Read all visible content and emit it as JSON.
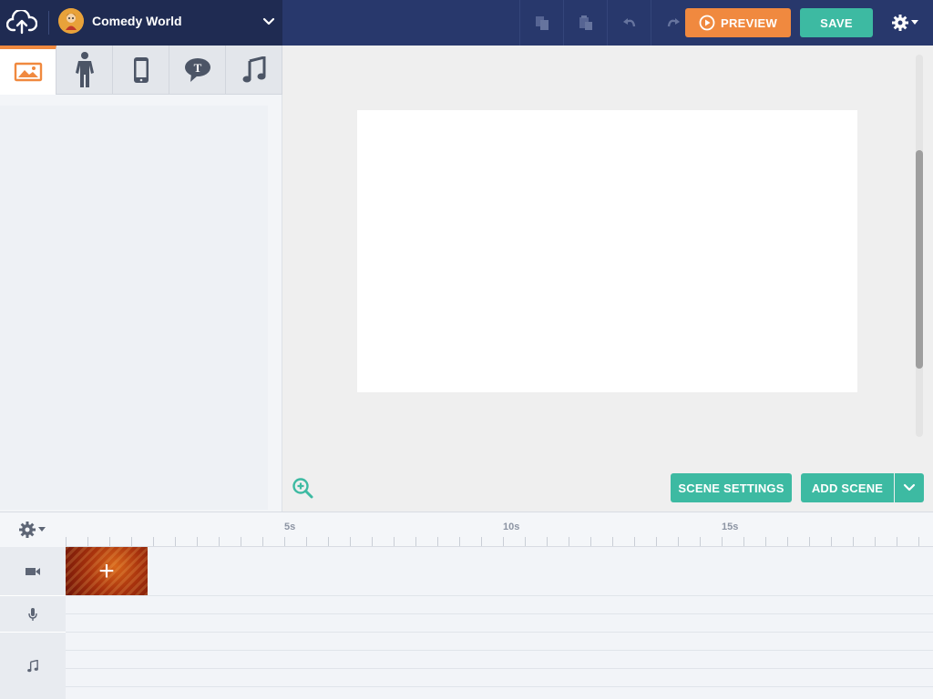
{
  "header": {
    "theme_title": "Comedy World",
    "upload_icon": "cloud-upload-icon",
    "tools": [
      "copy-icon",
      "paste-icon",
      "undo-icon",
      "redo-icon"
    ],
    "preview_label": "PREVIEW",
    "save_label": "SAVE",
    "settings_icon": "gear-icon"
  },
  "asset_panel": {
    "tabs": [
      {
        "name": "backgrounds",
        "icon": "image-icon",
        "active": true
      },
      {
        "name": "characters",
        "icon": "character-icon",
        "active": false
      },
      {
        "name": "props",
        "icon": "phone-icon",
        "active": false
      },
      {
        "name": "text",
        "icon": "speech-bubble-icon",
        "active": false
      },
      {
        "name": "music",
        "icon": "music-note-icon",
        "active": false
      }
    ]
  },
  "stage": {
    "scene_settings_label": "SCENE SETTINGS",
    "add_scene_label": "ADD SCENE",
    "zoom_icon": "zoom-in-icon"
  },
  "timeline": {
    "ticks": [
      "5s",
      "10s",
      "15s"
    ],
    "rows": [
      {
        "name": "video",
        "icon": "video-camera-icon"
      },
      {
        "name": "voice",
        "icon": "microphone-icon"
      },
      {
        "name": "music",
        "icon": "music-note-icon"
      }
    ],
    "add_scene_symbol": "+"
  },
  "colors": {
    "header_bg": "#28386c",
    "accent_orange": "#f0893f",
    "accent_teal": "#3dbaa2"
  }
}
